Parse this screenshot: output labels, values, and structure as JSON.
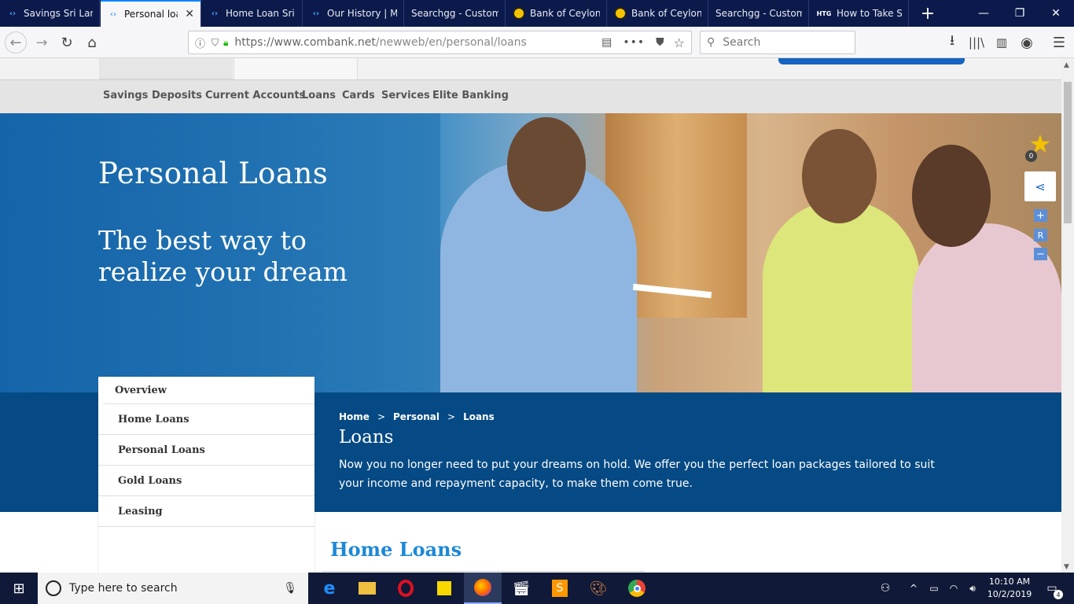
{
  "browser": {
    "tabs": [
      {
        "label": "Savings Sri Lanka",
        "icon": "combank-icon",
        "active": false
      },
      {
        "label": "Personal loans",
        "icon": "combank-icon",
        "active": true
      },
      {
        "label": "Home Loan Sri Lanka",
        "icon": "combank-icon",
        "active": false
      },
      {
        "label": "Our History | Mo",
        "icon": "combank-icon",
        "active": false
      },
      {
        "label": "Searchgg - Custom",
        "icon": "none",
        "active": false
      },
      {
        "label": "Bank of Ceylon",
        "icon": "boc-icon",
        "active": false
      },
      {
        "label": "Bank of Ceylon",
        "icon": "boc-icon",
        "active": false
      },
      {
        "label": "Searchgg - Custom",
        "icon": "none",
        "active": false
      },
      {
        "label": "How to Take Scr",
        "icon": "htg-icon",
        "active": false
      }
    ],
    "htg_icon_text": "HTG",
    "url": "https://www.combank.net/newweb/en/personal/loans",
    "url_host": "https://www.combank.net",
    "url_path": "/newweb/en/personal/loans",
    "search_placeholder": "Search"
  },
  "site": {
    "main_nav": [
      "Savings",
      "Deposits",
      "Current Accounts",
      "Loans",
      "Cards",
      "Services",
      "Elite Banking"
    ],
    "hero": {
      "title": "Personal Loans",
      "subtitle_line1": "The best way to",
      "subtitle_line2": "realize your dream"
    },
    "breadcrumb": [
      "Home",
      ">",
      "Personal",
      ">",
      "Loans"
    ],
    "section_title": "Loans",
    "section_desc": "Now you no longer need to put your dreams on hold. We offer you the perfect loan packages tailored to suit your income and repayment capacity, to make them come true.",
    "side_nav": {
      "overview": "Overview",
      "items": [
        "Home Loans",
        "Personal Loans",
        "Gold Loans",
        "Leasing"
      ]
    },
    "content_heading": "Home Loans",
    "favorite_count": "0",
    "zoom_controls": {
      "plus": "+",
      "reset": "R",
      "minus": "−"
    }
  },
  "taskbar": {
    "search_placeholder": "Type here to search",
    "time": "10:10 AM",
    "date": "10/2/2019",
    "notification_count": "4"
  },
  "colors": {
    "hero_blue": "#1a6aa8",
    "band_blue": "#054a84",
    "heading_blue": "#1e88d6",
    "browser_tab_bg": "#0c1a4b"
  }
}
